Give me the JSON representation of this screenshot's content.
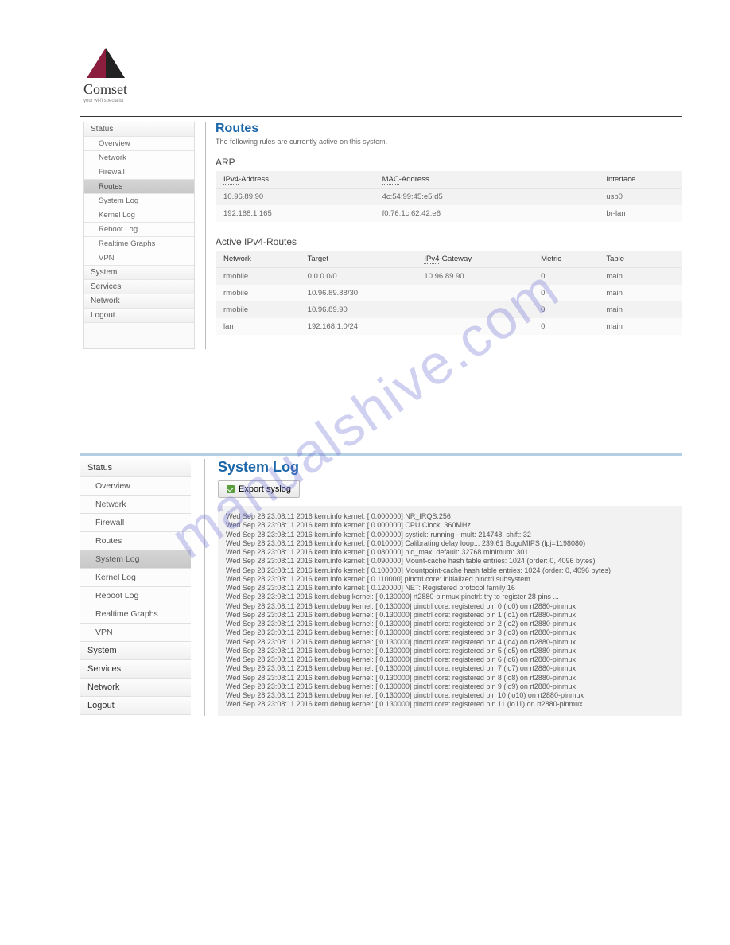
{
  "brand": {
    "name": "Comset",
    "tagline": "your wi-fi specialist"
  },
  "watermark": "manualshive.com",
  "screenshot1": {
    "sidebar": {
      "items": [
        {
          "label": "Status",
          "type": "top"
        },
        {
          "label": "Overview",
          "type": "sub"
        },
        {
          "label": "Network",
          "type": "sub"
        },
        {
          "label": "Firewall",
          "type": "sub"
        },
        {
          "label": "Routes",
          "type": "sub",
          "active": true
        },
        {
          "label": "System Log",
          "type": "sub"
        },
        {
          "label": "Kernel Log",
          "type": "sub"
        },
        {
          "label": "Reboot Log",
          "type": "sub"
        },
        {
          "label": "Realtime Graphs",
          "type": "sub"
        },
        {
          "label": "VPN",
          "type": "sub"
        },
        {
          "label": "System",
          "type": "top"
        },
        {
          "label": "Services",
          "type": "top"
        },
        {
          "label": "Network",
          "type": "top"
        },
        {
          "label": "Logout",
          "type": "top"
        }
      ]
    },
    "content": {
      "title": "Routes",
      "subtitle": "The following rules are currently active on this system.",
      "arp": {
        "heading": "ARP",
        "headers": [
          "IPv4-Address",
          "MAC-Address",
          "Interface"
        ],
        "rows": [
          [
            "10.96.89.90",
            "4c:54:99:45:e5:d5",
            "usb0"
          ],
          [
            "192.168.1.165",
            "f0:76:1c:62:42:e6",
            "br-lan"
          ]
        ]
      },
      "routes": {
        "heading": "Active IPv4-Routes",
        "headers": [
          "Network",
          "Target",
          "IPv4-Gateway",
          "Metric",
          "Table"
        ],
        "rows": [
          [
            "rmobile",
            "0.0.0.0/0",
            "10.96.89.90",
            "0",
            "main"
          ],
          [
            "rmobile",
            "10.96.89.88/30",
            "",
            "0",
            "main"
          ],
          [
            "rmobile",
            "10.96.89.90",
            "",
            "0",
            "main"
          ],
          [
            "lan",
            "192.168.1.0/24",
            "",
            "0",
            "main"
          ]
        ]
      }
    }
  },
  "screenshot2": {
    "sidebar": {
      "items": [
        {
          "label": "Status",
          "type": "top"
        },
        {
          "label": "Overview",
          "type": "sub"
        },
        {
          "label": "Network",
          "type": "sub"
        },
        {
          "label": "Firewall",
          "type": "sub"
        },
        {
          "label": "Routes",
          "type": "sub"
        },
        {
          "label": "System Log",
          "type": "sub",
          "active": true
        },
        {
          "label": "Kernel Log",
          "type": "sub"
        },
        {
          "label": "Reboot Log",
          "type": "sub"
        },
        {
          "label": "Realtime Graphs",
          "type": "sub"
        },
        {
          "label": "VPN",
          "type": "sub"
        },
        {
          "label": "System",
          "type": "top"
        },
        {
          "label": "Services",
          "type": "top"
        },
        {
          "label": "Network",
          "type": "top"
        },
        {
          "label": "Logout",
          "type": "top"
        }
      ]
    },
    "content": {
      "title": "System Log",
      "export_label": "Export syslog",
      "log_lines": [
        "Wed Sep 28 23:08:11 2016 kern.info kernel: [    0.000000] NR_IRQS:256",
        "Wed Sep 28 23:08:11 2016 kern.info kernel: [    0.000000] CPU Clock: 360MHz",
        "Wed Sep 28 23:08:11 2016 kern.info kernel: [    0.000000] systick: running - mult: 214748, shift: 32",
        "Wed Sep 28 23:08:11 2016 kern.info kernel: [    0.010000] Calibrating delay loop... 239.61 BogoMIPS (lpj=1198080)",
        "Wed Sep 28 23:08:11 2016 kern.info kernel: [    0.080000] pid_max: default: 32768 minimum: 301",
        "Wed Sep 28 23:08:11 2016 kern.info kernel: [    0.090000] Mount-cache hash table entries: 1024 (order: 0, 4096 bytes)",
        "Wed Sep 28 23:08:11 2016 kern.info kernel: [    0.100000] Mountpoint-cache hash table entries: 1024 (order: 0, 4096 bytes)",
        "Wed Sep 28 23:08:11 2016 kern.info kernel: [    0.110000] pinctrl core: initialized pinctrl subsystem",
        "Wed Sep 28 23:08:11 2016 kern.info kernel: [    0.120000] NET: Registered protocol family 16",
        "Wed Sep 28 23:08:11 2016 kern.debug kernel: [    0.130000] rt2880-pinmux pinctrl: try to register 28 pins ...",
        "Wed Sep 28 23:08:11 2016 kern.debug kernel: [    0.130000] pinctrl core: registered pin 0 (io0) on rt2880-pinmux",
        "Wed Sep 28 23:08:11 2016 kern.debug kernel: [    0.130000] pinctrl core: registered pin 1 (io1) on rt2880-pinmux",
        "Wed Sep 28 23:08:11 2016 kern.debug kernel: [    0.130000] pinctrl core: registered pin 2 (io2) on rt2880-pinmux",
        "Wed Sep 28 23:08:11 2016 kern.debug kernel: [    0.130000] pinctrl core: registered pin 3 (io3) on rt2880-pinmux",
        "Wed Sep 28 23:08:11 2016 kern.debug kernel: [    0.130000] pinctrl core: registered pin 4 (io4) on rt2880-pinmux",
        "Wed Sep 28 23:08:11 2016 kern.debug kernel: [    0.130000] pinctrl core: registered pin 5 (io5) on rt2880-pinmux",
        "Wed Sep 28 23:08:11 2016 kern.debug kernel: [    0.130000] pinctrl core: registered pin 6 (io6) on rt2880-pinmux",
        "Wed Sep 28 23:08:11 2016 kern.debug kernel: [    0.130000] pinctrl core: registered pin 7 (io7) on rt2880-pinmux",
        "Wed Sep 28 23:08:11 2016 kern.debug kernel: [    0.130000] pinctrl core: registered pin 8 (io8) on rt2880-pinmux",
        "Wed Sep 28 23:08:11 2016 kern.debug kernel: [    0.130000] pinctrl core: registered pin 9 (io9) on rt2880-pinmux",
        "Wed Sep 28 23:08:11 2016 kern.debug kernel: [    0.130000] pinctrl core: registered pin 10 (io10) on rt2880-pinmux",
        "Wed Sep 28 23:08:11 2016 kern.debug kernel: [    0.130000] pinctrl core: registered pin 11 (io11) on rt2880-pinmux"
      ]
    }
  }
}
